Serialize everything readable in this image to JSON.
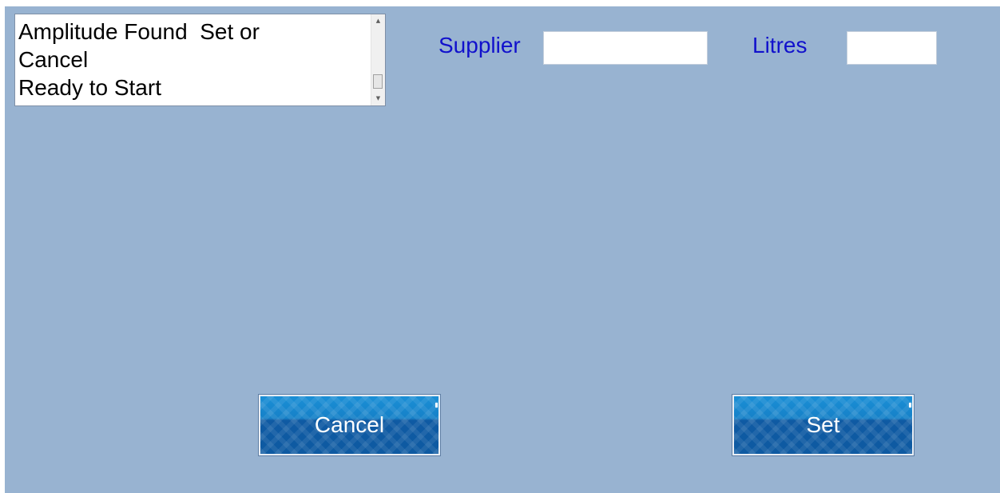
{
  "log": {
    "lines": "Amplitude Found  Set or\nCancel\nReady to Start",
    "scroll_up_icon": "▲",
    "scroll_down_icon": "▼"
  },
  "supplier": {
    "label": "Supplier",
    "value": ""
  },
  "litres": {
    "label": "Litres",
    "value": ""
  },
  "buttons": {
    "cancel_label": "Cancel",
    "set_label": "Set"
  },
  "colors": {
    "background": "#98b3d1",
    "label_text": "#1111cc",
    "button_top": "#1a8fd6",
    "button_bottom": "#0e5aa2"
  }
}
